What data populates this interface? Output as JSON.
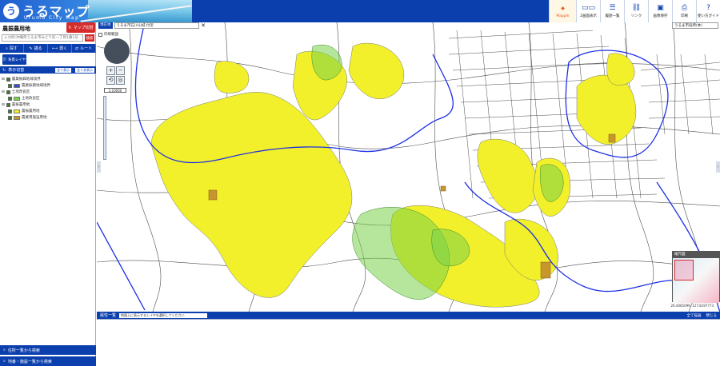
{
  "app": {
    "logo_title": "うるマップ",
    "logo_sub": "Urumo City Map"
  },
  "toolbar": [
    {
      "name": "mapple-button",
      "icon": "mapple-logo",
      "label": "Mapple"
    },
    {
      "name": "dual-screen-button",
      "icon": "dual-screen-icon",
      "label": "2画面表示"
    },
    {
      "name": "history-list-button",
      "icon": "history-icon",
      "label": "履歴一覧"
    },
    {
      "name": "link-button",
      "icon": "link-icon",
      "label": "リンク"
    },
    {
      "name": "image-save-button",
      "icon": "folder-icon",
      "label": "画像保存"
    },
    {
      "name": "print-button",
      "icon": "print-icon",
      "label": "印刷"
    },
    {
      "name": "guide-button",
      "icon": "guide-icon",
      "label": "使い方ガイド"
    }
  ],
  "left_panel": {
    "title": "農振農用地",
    "map_switch_label": "マップ切替",
    "search_placeholder": "入力例:沖縄県うるま市みどり町一丁目1番1号",
    "search_button": "検索",
    "func_tabs": [
      {
        "name": "search",
        "icon": "search-icon",
        "label": "探す"
      },
      {
        "name": "draw",
        "icon": "pencil-icon",
        "label": "描る"
      },
      {
        "name": "measure",
        "icon": "ruler-icon",
        "label": "測く"
      },
      {
        "name": "route",
        "icon": "route-icon",
        "label": "ルート"
      }
    ],
    "layer_tile_label": "背景レイヤ",
    "legend_title": "表示切替",
    "legend_buttons": [
      "全て表示",
      "全て非表示"
    ],
    "legend": [
      {
        "type": "group",
        "label": "農業振興地域境界",
        "checked": true
      },
      {
        "type": "item",
        "label": "農業振興地域境界",
        "swatch": "#3a4cc8",
        "checked": true
      },
      {
        "type": "group",
        "label": "土地改良区",
        "checked": true
      },
      {
        "type": "item",
        "label": "土地改良区",
        "swatch": "#7ad24a",
        "checked": true
      },
      {
        "type": "group",
        "label": "農振農用地",
        "checked": true
      },
      {
        "type": "item",
        "label": "農振農用地",
        "swatch": "#f2f02a",
        "checked": true
      },
      {
        "type": "item",
        "label": "農業用施設用地",
        "swatch": "#c9962e",
        "checked": true
      }
    ],
    "bottom_buttons": [
      "住所一覧から検索",
      "地番・施設一覧から検索"
    ]
  },
  "map": {
    "address_tag": "現在地",
    "address_value": "うるま市石川山城 付近",
    "city_select": "うるま市役所(本)",
    "print_area_label": "印刷範囲",
    "scale_value": "1:10000",
    "coords": "26.4065099, 127.8197773",
    "overview_title": "縮尺図",
    "colors": {
      "farmland": "#f2f02a",
      "facility": "#c9962e",
      "improvement": "#7ad24a",
      "boundary": "#1e2fe6",
      "road": "#111111"
    }
  },
  "attr_bar": {
    "title": "属性一覧",
    "select_placeholder": "地図上に表示するレイヤを選択してください",
    "right_links": [
      "全て描画",
      "閉じる"
    ]
  }
}
